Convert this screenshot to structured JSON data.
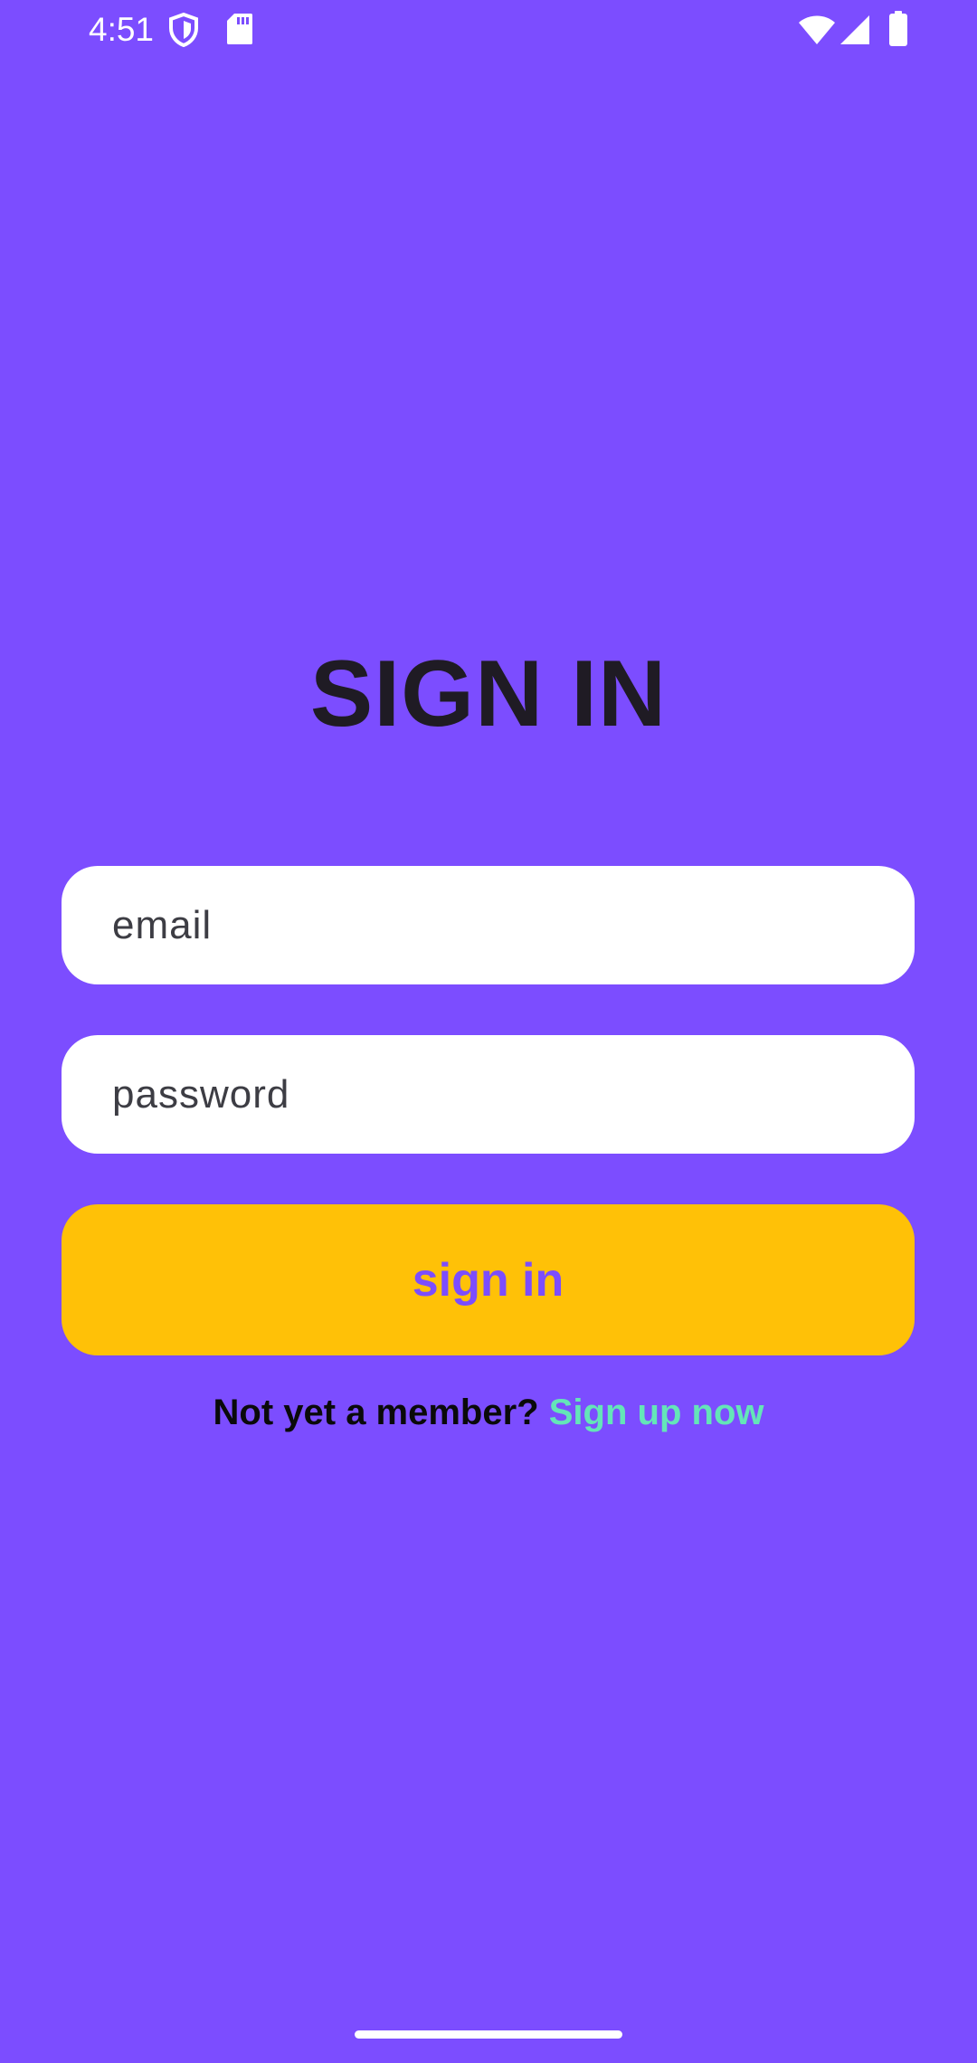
{
  "status_bar": {
    "time": "4:51",
    "icons": [
      "shield-icon",
      "sd-card-icon",
      "wifi-icon",
      "signal-icon",
      "battery-icon"
    ]
  },
  "title": "SIGN IN",
  "form": {
    "email_placeholder": "email",
    "password_placeholder": "password",
    "submit_label": "sign in"
  },
  "footer": {
    "prompt": "Not yet a member?",
    "link_label": "Sign up now"
  },
  "colors": {
    "background": "#7c4dff",
    "button": "#ffc107",
    "button_text": "#7c4dff",
    "link": "#64e5b8"
  }
}
